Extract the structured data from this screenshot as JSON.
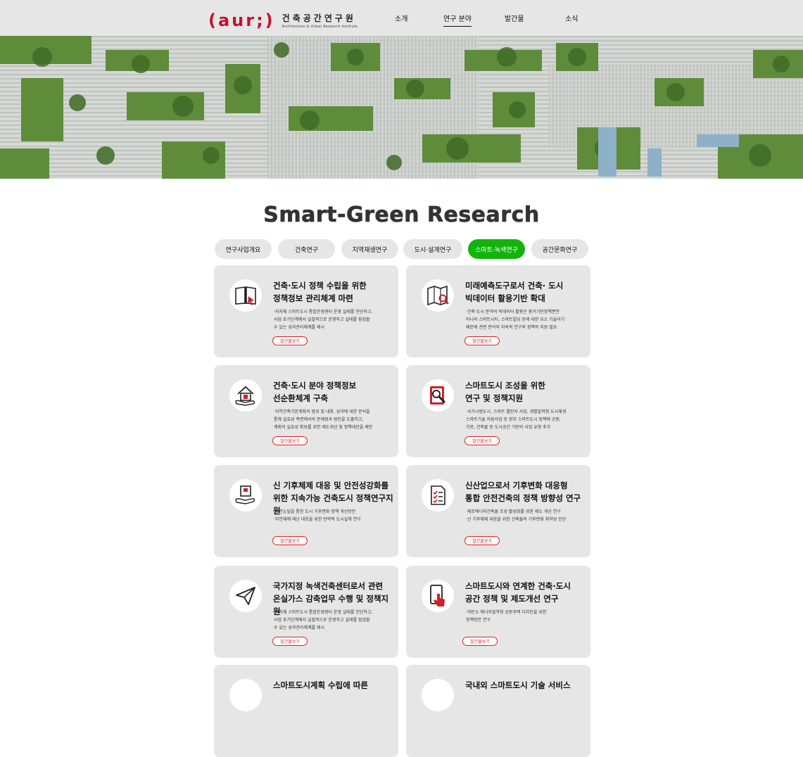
{
  "header": {
    "logo_mark": "(aur;)",
    "logo_name_ko": "건축공간연구원",
    "logo_name_en": "Architecture & Urban Research Institute",
    "nav": [
      {
        "label": "소개",
        "active": false
      },
      {
        "label": "연구 분야",
        "active": true
      },
      {
        "label": "발간물",
        "active": false
      },
      {
        "label": "소식",
        "active": false
      }
    ]
  },
  "page_title": "Smart-Green Research",
  "tabs": [
    {
      "label": "연구사업개요",
      "active": false
    },
    {
      "label": "건축연구",
      "active": false
    },
    {
      "label": "지역재생연구",
      "active": false
    },
    {
      "label": "도시·설계연구",
      "active": false
    },
    {
      "label": "스마트·녹색연구",
      "active": true
    },
    {
      "label": "공간문화연구",
      "active": false
    }
  ],
  "cards": [
    {
      "icon": "book-icon",
      "title_line1": "건축·도시 정책 수립을 위한",
      "title_line2": "정책정보 관리체계 마련",
      "desc": "·지자체 스마트도시 통합운영센터 운영 실태를 진단하고,\n사업 초기단계에서 실질적으로 운영하고 실태를 점검할\n수 있는 성과관리체계를 제시",
      "button": "발간물보기"
    },
    {
      "icon": "map-search-icon",
      "title_line1": "미래예측도구로서 건축· 도시",
      "title_line2": "빅데이터 활용기반 확대",
      "desc": "·건축·도시 분야의 빅데이터 활용은 중거기반정책뿐만\n아니라 스마트시티, 스마트빌딩 등에 대한 요소 기술이기\n때문에 관련 분야의 지속적 연구와 정책적 지원 필요",
      "button": "발간물보기"
    },
    {
      "icon": "house-hand-icon",
      "title_line1": "건축·도시 분야 정책정보",
      "title_line2": "선순환체계 구축",
      "desc": "·지역건축기본계획의 범위 및 내용, 성과에 대한 분석을\n통해 실효성 측면에서의 문제점과 원인을 도출하고,\n계획의 실효성 확보를 위한 제도개선 및 정책대안을 제안",
      "button": "발간물보기"
    },
    {
      "icon": "document-search-icon",
      "title_line1": "스마트도시 조성을 위한",
      "title_line2": "연구 및 정책지원",
      "desc": "·국가시범도시, 스마트 챌린지 사업, 생활밀착형 도시재생\n스마트기술 지원사업 등 정부 스마트도시 정책에 공원,\n가로, 건축물 등 도시공간 기반의 사업 유형 추가",
      "button": "발간물보기"
    },
    {
      "icon": "box-hand-icon",
      "title_line1": "신 기후체제 대응 및 안전성강화를",
      "title_line2": "위한 지속가능 건축도시 정책연구지원",
      "desc": "·그린뉴딜을 통한 도시 기후변화 정책 개선방안\n·자연재해·재난 대응을 위한 탄력적 도시설계 연구",
      "button": "발간물보기"
    },
    {
      "icon": "checklist-icon",
      "title_line1": "신산업으로서 기후변화 대응형",
      "title_line2": "통합 안전건축의 정책 방향성 연구",
      "desc": "·제로에너지건축물 조성 활성화를 위한 제도 개선 연구\n·신 기후체제 대응을 위한 건축물의 기후변화 취약성 진단",
      "button": "발간물보기"
    },
    {
      "icon": "paper-plane-icon",
      "title_line1": "국가지정 녹색건축센터로서 관련",
      "title_line2": "온실가스 감축업무 수행 및 정책지원",
      "desc": "·지자체 스마트도시 통합운영센터 운영 실태를 진단하고,\n사업 초기단계에서 실질적으로 운영하고 실태를 점검할\n수 있는 성과관리체계를 제시",
      "button": "발간물보기"
    },
    {
      "icon": "tablet-touch-icon",
      "title_line1": "스마트도시와 연계한 건축·도시",
      "title_line2": "공간 정책 및 제도개선 연구",
      "desc": "·저탄소 에너지절약형 공동주택 디자인을 위한\n정책방안 연구",
      "button": "발간물보기"
    },
    {
      "icon": "circle-icon",
      "title_line1": "스마트도시계획 수립에 따른",
      "title_line2": "",
      "desc": "",
      "button": ""
    },
    {
      "icon": "circle-icon",
      "title_line1": "국내외 스마트도시 기술 서비스",
      "title_line2": "",
      "desc": "",
      "button": ""
    }
  ]
}
